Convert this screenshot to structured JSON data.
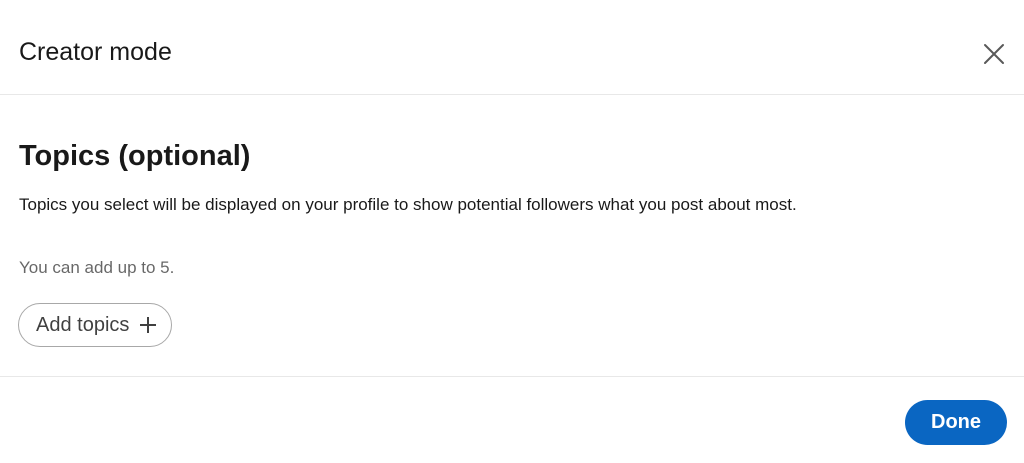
{
  "modal": {
    "title": "Creator mode",
    "close_icon": "close-icon"
  },
  "topics": {
    "heading": "Topics (optional)",
    "description": "Topics you select will be displayed on your profile to show potential followers what you post about most.",
    "hint": "You can add up to 5.",
    "add_button_label": "Add topics",
    "add_icon": "plus-icon"
  },
  "footer": {
    "done_label": "Done"
  },
  "colors": {
    "primary": "#0a66c2",
    "divider": "#e8e8e8",
    "text_muted": "#666666"
  }
}
